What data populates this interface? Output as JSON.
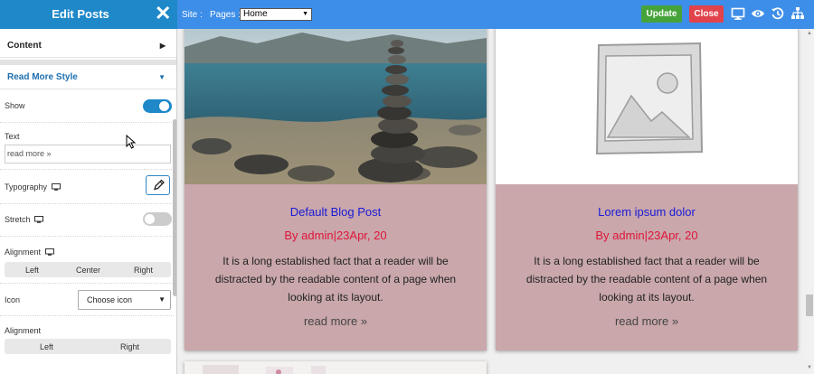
{
  "panel": {
    "title": "Edit Posts",
    "sections": {
      "content": "Content",
      "read_more_style": "Read More Style"
    },
    "show_label": "Show",
    "show_on": true,
    "text_label": "Text",
    "text_value": "read more »",
    "typography_label": "Typography",
    "stretch_label": "Stretch",
    "stretch_on": false,
    "alignment_label": "Alignment",
    "alignment_options": [
      "Left",
      "Center",
      "Right"
    ],
    "icon_label": "Icon",
    "icon_select_value": "Choose icon",
    "icon_alignment_label": "Alignment",
    "icon_alignment_options": [
      "Left",
      "Right"
    ]
  },
  "toolbar": {
    "site_label": "Site :",
    "pages_label": "Pages :",
    "pages_value": "Home",
    "update_label": "Update",
    "close_label": "Close",
    "icons": [
      "desktop-icon",
      "eye-icon",
      "history-icon",
      "sitemap-icon"
    ]
  },
  "posts": [
    {
      "title": "Default Blog Post",
      "meta": "By admin|23Apr, 20",
      "excerpt": "It is a long established fact that a reader will be distracted by the readable content of a page when looking at its layout.",
      "read_more": "read more »"
    },
    {
      "title": "Lorem ipsum dolor",
      "meta": "By admin|23Apr, 20",
      "excerpt": "It is a long established fact that a reader will be distracted by the readable content of a page when looking at its layout.",
      "read_more": "read more »"
    }
  ],
  "colors": {
    "topbar": "#3d8ee8",
    "panel_header": "#1e88c9",
    "toggle_on": "#1e88c9",
    "toggle_off": "#cccccc",
    "update": "#45a33a",
    "close": "#e2424a",
    "card_bg": "#c9a7ab",
    "post_title": "#1a1ad6",
    "post_meta": "#e0153a"
  }
}
